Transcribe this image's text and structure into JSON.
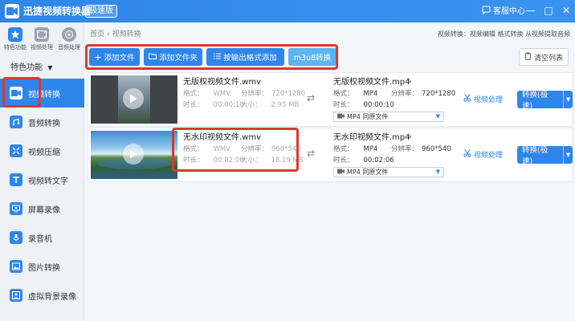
{
  "app": {
    "title": "迅捷视频转换器",
    "edition": "极速版",
    "support_label": "客服中心",
    "window_controls": [
      "—",
      "□",
      "✕"
    ]
  },
  "sidebar": {
    "tools": [
      {
        "label": "特色功能",
        "icon": "star-icon"
      },
      {
        "label": "视频处理",
        "icon": "film-icon"
      },
      {
        "label": "音频处理",
        "icon": "audio-disc-icon"
      }
    ],
    "features_label": "特色功能",
    "items": [
      {
        "label": "视频转换",
        "icon": "video-convert-icon",
        "active": true
      },
      {
        "label": "音频转换",
        "icon": "audio-convert-icon",
        "active": false
      },
      {
        "label": "视频压缩",
        "icon": "compress-icon",
        "active": false
      },
      {
        "label": "视频转文字",
        "icon": "text-icon",
        "active": false
      },
      {
        "label": "屏幕录像",
        "icon": "screen-record-icon",
        "active": false
      },
      {
        "label": "录音机",
        "icon": "recorder-icon",
        "active": false
      },
      {
        "label": "图片转换",
        "icon": "image-icon",
        "active": false
      },
      {
        "label": "虚拟背景录像",
        "icon": "virtual-bg-icon",
        "active": false
      }
    ]
  },
  "breadcrumb": {
    "home": "首页",
    "sep": "›",
    "current": "视频转换"
  },
  "header_right": "视频转换：视频编辑 格式转换 从视频提取音频",
  "toolbar": {
    "add_file": "添加文件",
    "add_folder": "添加文件夹",
    "add_by_format": "按输出格式添加",
    "m3u8": "m3u8转换",
    "clear_list": "清空列表"
  },
  "labels": {
    "format": "格式：",
    "resolution": "分辨率：",
    "duration": "时长：",
    "size": "大小：",
    "video_process": "视频处理",
    "convert": "转换(极速)"
  },
  "files": [
    {
      "name": "无版权视频文件.wmv",
      "format": "WMV",
      "resolution": "720*1280",
      "duration": "00:00:10",
      "size": "2.95 MB",
      "output_name": "无版权视频文件.mp4",
      "output_format": "MP4",
      "output_resolution": "720*1280",
      "output_duration": "00:00:10",
      "output_preset": "MP4  同原文件"
    },
    {
      "name": "无水印视频文件.wmv",
      "format": "WMV",
      "resolution": "960*540",
      "duration": "00:02:06",
      "size": "18.19 MB",
      "output_name": "无水印视频文件.mp4",
      "output_format": "MP4",
      "output_resolution": "960*540",
      "output_duration": "00:02:06",
      "output_preset": "MP4  同原文件"
    }
  ],
  "colors": {
    "primary": "#2e86ea",
    "highlight": "#d9392f",
    "light_button": "#5bb5f2"
  }
}
